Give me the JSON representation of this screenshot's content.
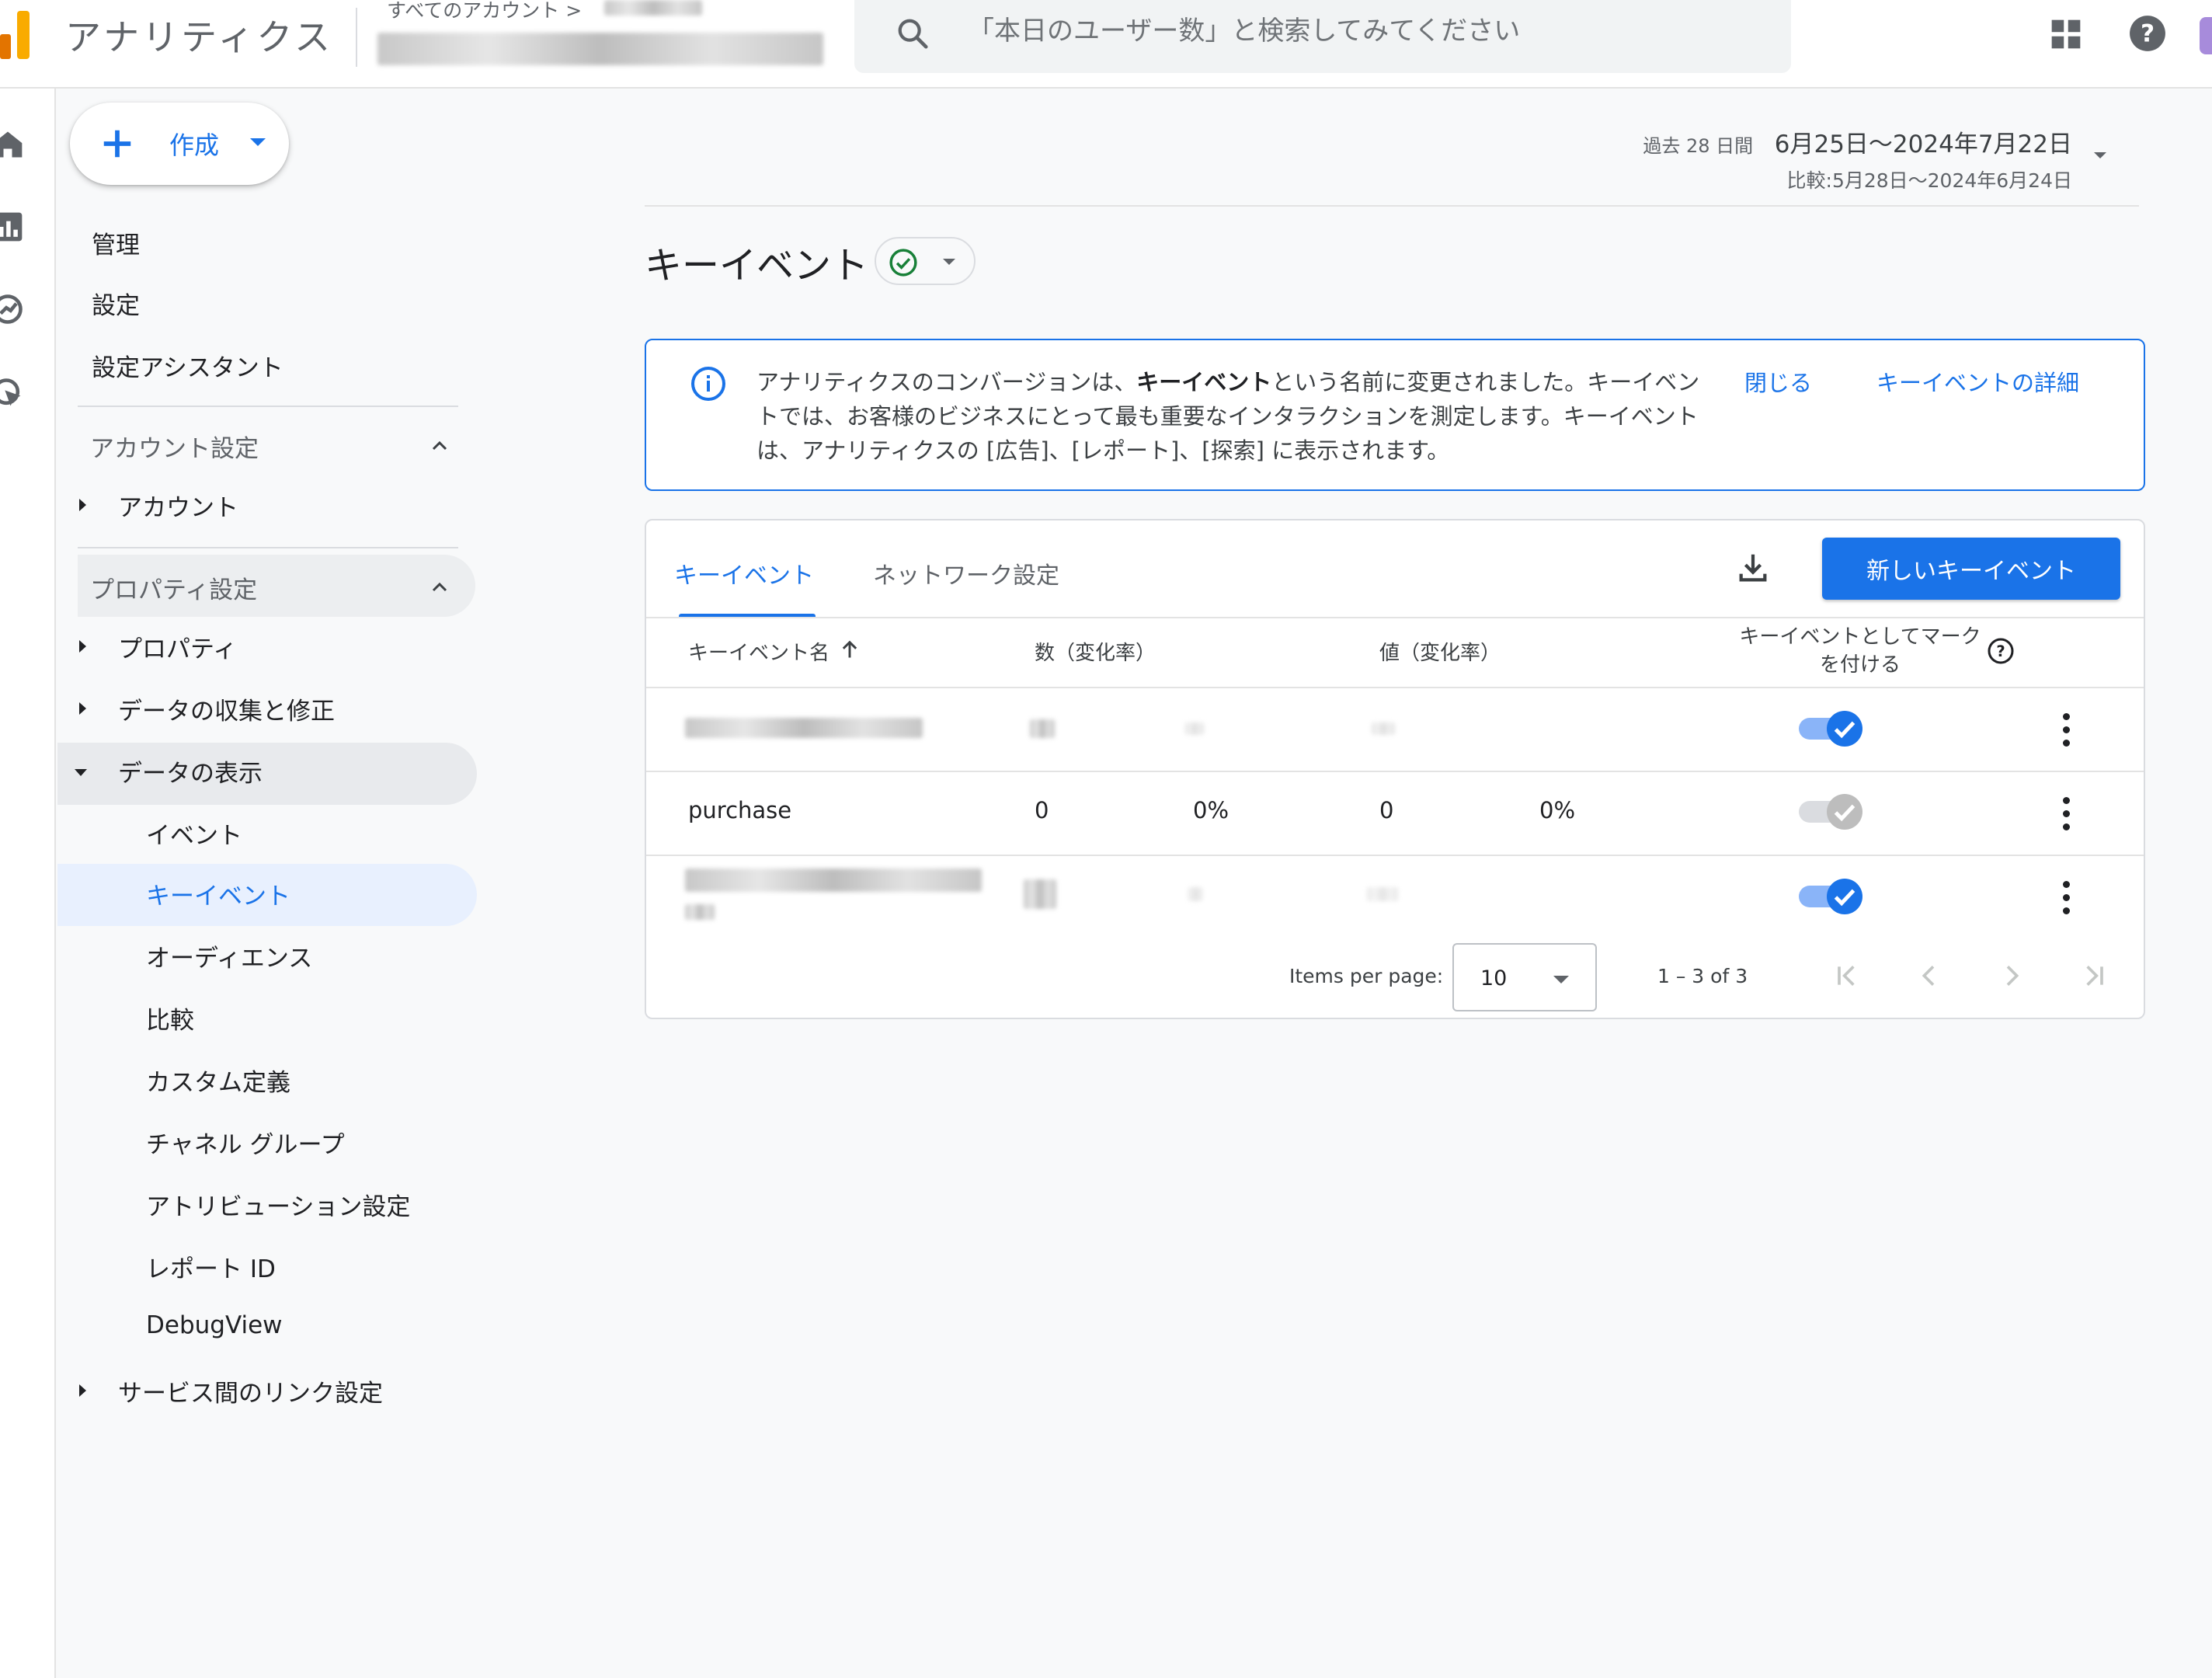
{
  "app": {
    "title": "アナリティクス",
    "breadcrumb": "すべてのアカウント >"
  },
  "search": {
    "placeholder": "「本日のユーザー数」と検索してみてください"
  },
  "colors": {
    "accent": "#1a73e8",
    "logo_orange": "#f9ab00",
    "logo_dark_orange": "#e37400",
    "success_green": "#188038"
  },
  "sidenav": {
    "create_label": "作成",
    "items": {
      "admin": "管理",
      "settings": "設定",
      "setup_assistant": "設定アシスタント",
      "account_settings": "アカウント設定",
      "account": "アカウント",
      "property_settings": "プロパティ設定",
      "property": "プロパティ",
      "data_collection": "データの収集と修正",
      "data_display": "データの表示",
      "events": "イベント",
      "key_events": "キーイベント",
      "audiences": "オーディエンス",
      "comparisons": "比較",
      "custom_definitions": "カスタム定義",
      "channel_groups": "チャネル グループ",
      "attribution_settings": "アトリビューション設定",
      "reporting_id": "レポート ID",
      "debugview": "DebugView",
      "product_links": "サービス間のリンク設定"
    }
  },
  "date_range": {
    "preset": "過去 28 日間",
    "range": "6月25日～2024年7月22日",
    "comparison": "比較:5月28日～2024年6月24日"
  },
  "page": {
    "title": "キーイベント"
  },
  "banner": {
    "text_before": "アナリティクスのコンバージョンは、",
    "text_bold": "キーイベント",
    "text_after": "という名前に変更されました。キーイベントでは、お客様のビジネスにとって最も重要なインタラクションを測定します。キーイベントは、アナリティクスの [広告]、[レポート]、[探索] に表示されます。",
    "close_link": "閉じる",
    "details_link": "キーイベントの詳細"
  },
  "card": {
    "tabs": [
      "キーイベント",
      "ネットワーク設定"
    ],
    "new_button": "新しいキーイベント",
    "columns": {
      "name": "キーイベント名",
      "count": "数（変化率）",
      "value": "値（変化率）",
      "mark_line1": "キーイベントとしてマーク",
      "mark_line2": "を付ける"
    },
    "rows": [
      {
        "name": "",
        "count": "",
        "count_change": "",
        "value": "",
        "value_change": "",
        "marked": true,
        "enabled": true
      },
      {
        "name": "purchase",
        "count": "0",
        "count_change": "0%",
        "value": "0",
        "value_change": "0%",
        "marked": true,
        "enabled": false
      },
      {
        "name": "",
        "count": "",
        "count_change": "",
        "value": "",
        "value_change": "",
        "marked": true,
        "enabled": true
      }
    ],
    "pager": {
      "items_per_page_label": "Items per page:",
      "items_per_page": "10",
      "range": "1 – 3 of 3"
    }
  }
}
